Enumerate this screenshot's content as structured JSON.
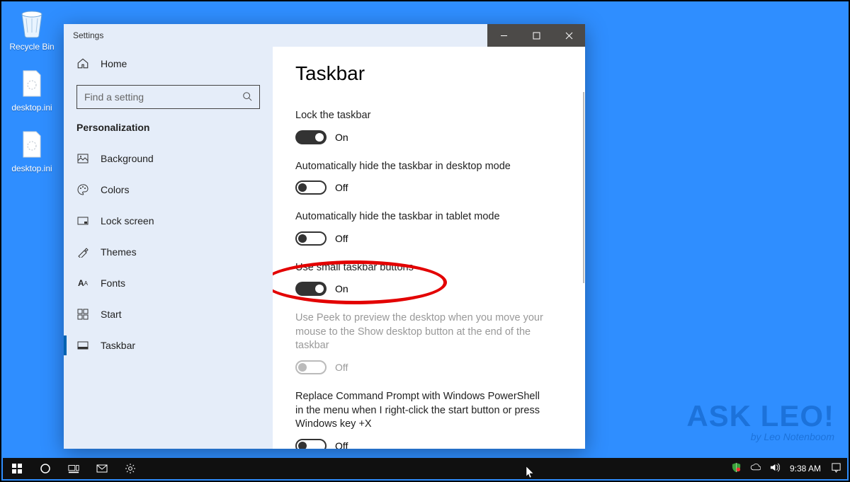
{
  "desktop": {
    "icons": [
      {
        "name": "Recycle Bin"
      },
      {
        "name": "desktop.ini"
      },
      {
        "name": "desktop.ini"
      }
    ]
  },
  "window": {
    "title": "Settings",
    "sidebar": {
      "home": "Home",
      "search_placeholder": "Find a setting",
      "category": "Personalization",
      "items": [
        {
          "label": "Background"
        },
        {
          "label": "Colors"
        },
        {
          "label": "Lock screen"
        },
        {
          "label": "Themes"
        },
        {
          "label": "Fonts"
        },
        {
          "label": "Start"
        },
        {
          "label": "Taskbar"
        }
      ]
    },
    "page": {
      "heading": "Taskbar",
      "settings": [
        {
          "label": "Lock the taskbar",
          "state": "On",
          "on": true
        },
        {
          "label": "Automatically hide the taskbar in desktop mode",
          "state": "Off",
          "on": false
        },
        {
          "label": "Automatically hide the taskbar in tablet mode",
          "state": "Off",
          "on": false
        },
        {
          "label": "Use small taskbar buttons",
          "state": "On",
          "on": true
        },
        {
          "label": "Use Peek to preview the desktop when you move your mouse to the Show desktop button at the end of the taskbar",
          "state": "Off",
          "on": false,
          "disabled": true
        },
        {
          "label": "Replace Command Prompt with Windows PowerShell in the menu when I right-click the start button or press Windows key +X",
          "state": "Off",
          "on": false
        }
      ]
    }
  },
  "taskbar": {
    "time": "9:38 AM"
  },
  "watermark": {
    "title": "ASK LEO!",
    "subtitle": "by Leo Notenboom"
  }
}
